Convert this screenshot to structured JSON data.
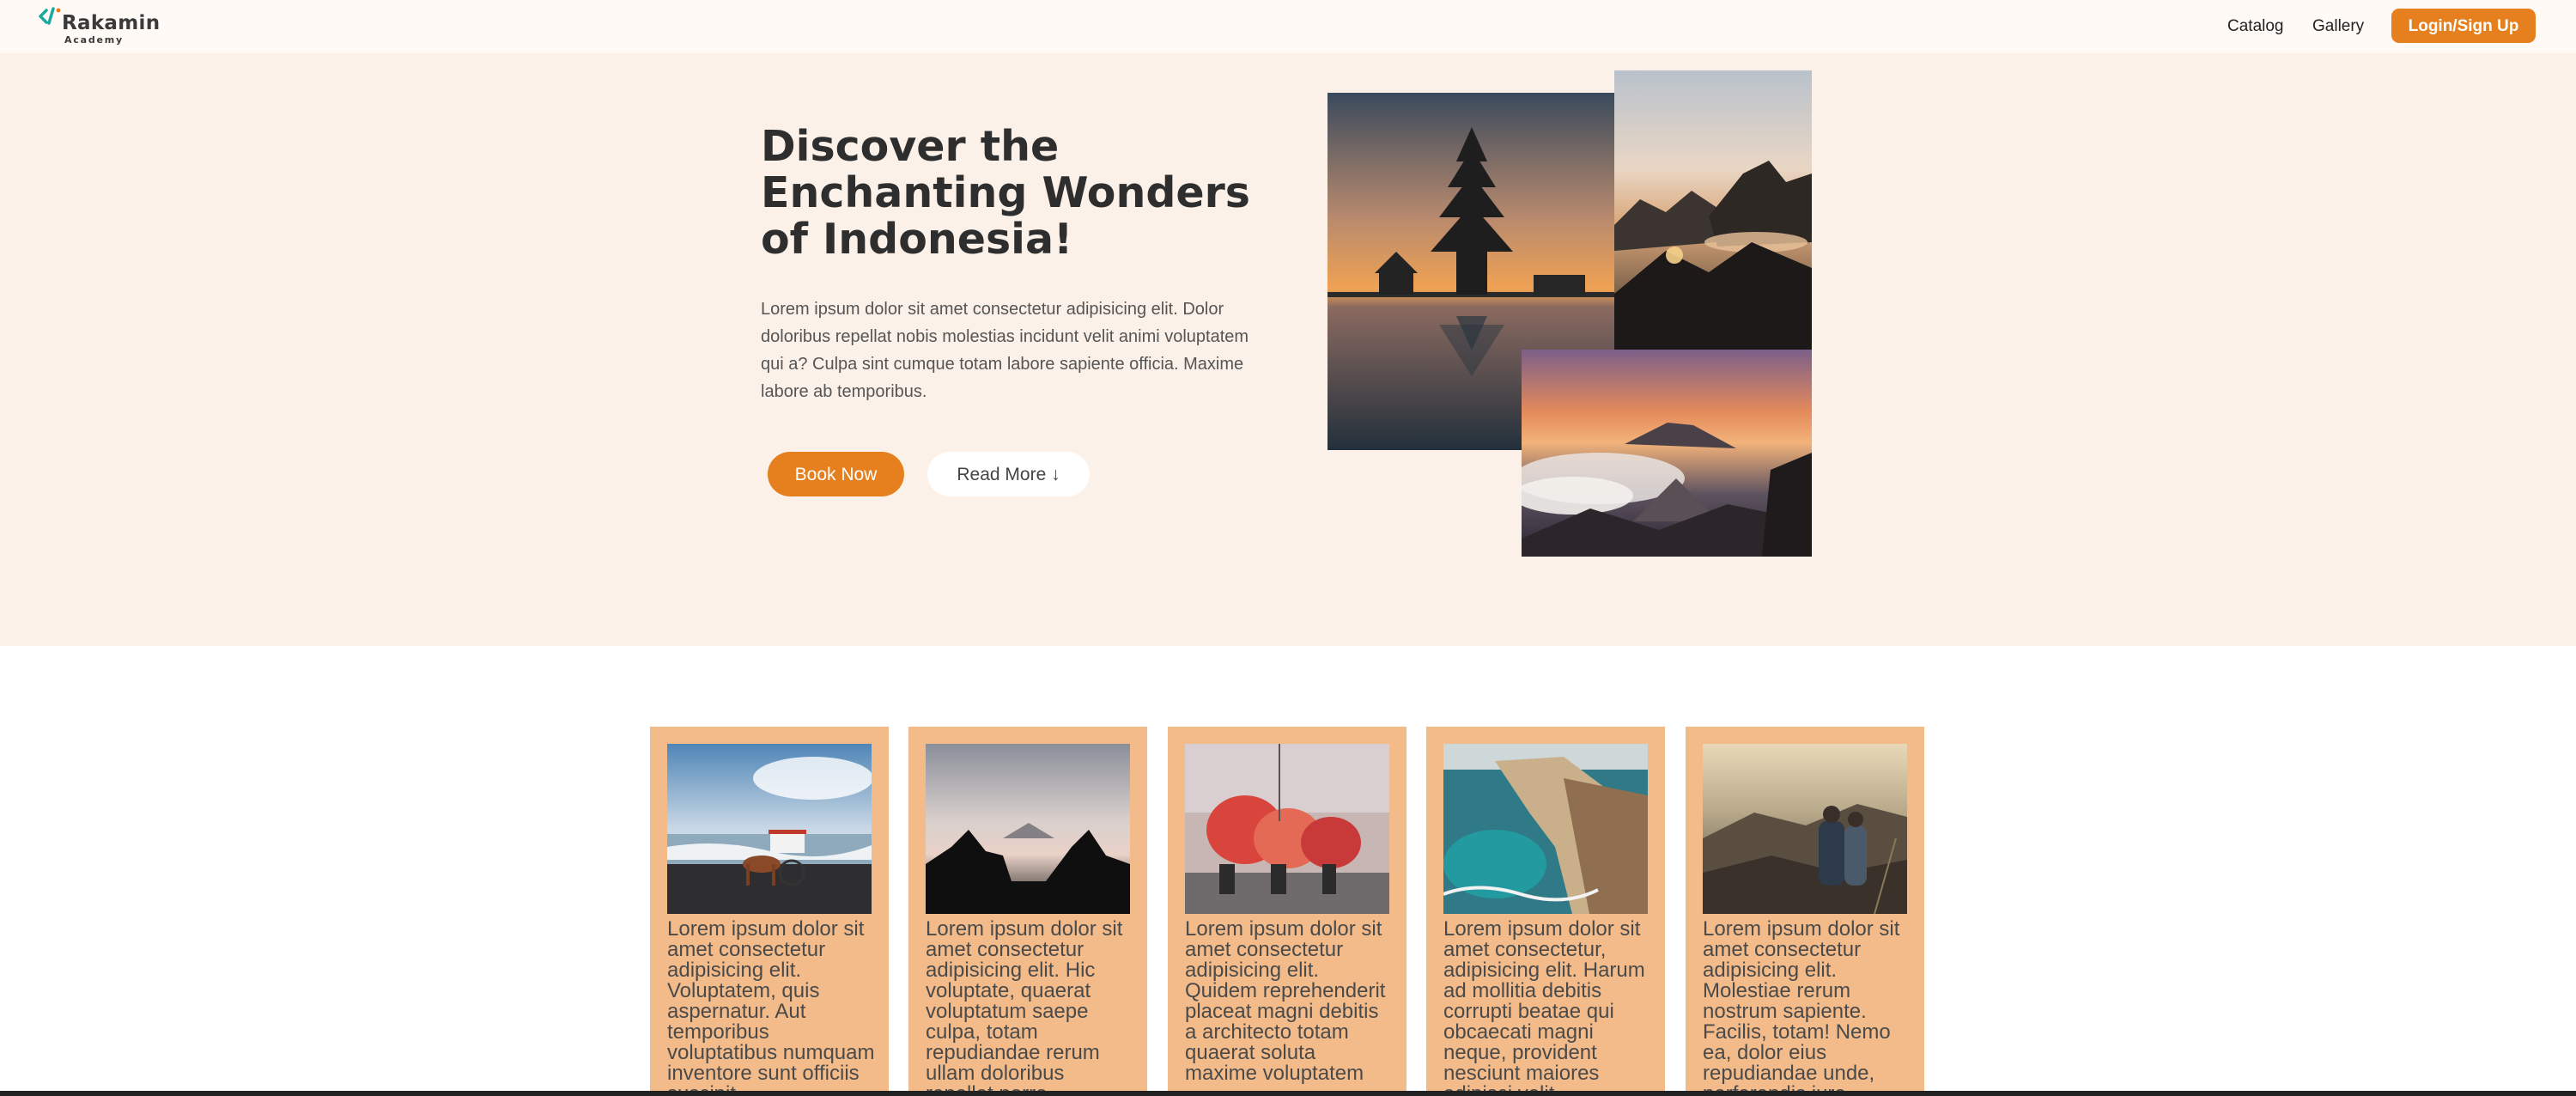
{
  "navbar": {
    "logo": {
      "name": "Rakamin",
      "sub": "Academy",
      "icon": "code-bracket-logo"
    },
    "links": [
      "Catalog",
      "Gallery"
    ],
    "login_label": "Login/Sign Up"
  },
  "hero": {
    "title": "Discover the Enchanting Wonders of Indonesia!",
    "description": "Lorem ipsum dolor sit amet consectetur adipisicing elit. Dolor doloribus repellat nobis molestias incidunt velit animi voluptatem qui a? Culpa sint cumque totam labore sapiente officia. Maxime labore ab temporibus.",
    "book_label": "Book Now",
    "read_label": "Read More ↓",
    "images": [
      "temple-on-lake-sunset",
      "rocky-islands-sunrise",
      "volcano-crater-clouds"
    ]
  },
  "cards": [
    {
      "image": "horse-cart-on-beach",
      "text": "Lorem ipsum dolor sit amet consectetur adipisicing elit. Voluptatem, quis aspernatur. Aut temporibus voluptatibus numquam inventore sunt officiis suscipit"
    },
    {
      "image": "temple-silhouette-dusk",
      "text": "Lorem ipsum dolor sit amet consectetur adipisicing elit. Hic voluptate, quaerat voluptatum saepe culpa, totam repudiandae rerum ullam doloribus repellat porro"
    },
    {
      "image": "street-dance-parade",
      "text": "Lorem ipsum dolor sit amet consectetur adipisicing elit. Quidem reprehenderit placeat magni debitis a architecto totam quaerat soluta maxime voluptatem"
    },
    {
      "image": "turquoise-sea-cliffs",
      "text": "Lorem ipsum dolor sit amet consectetur, adipisicing elit. Harum ad mollitia debitis corrupti beatae qui obcaecati magni neque, provident nesciunt maiores adipisci velit"
    },
    {
      "image": "hikers-on-mountain",
      "text": "Lorem ipsum dolor sit amet consectetur adipisicing elit. Molestiae rerum nostrum sapiente. Facilis, totam! Nemo ea, dolor eius repudiandae unde, perferendis iure"
    }
  ],
  "colors": {
    "accent": "#e6801f",
    "hero_bg": "#fbf1e8",
    "card_bg": "#f3bb8a",
    "logo_accent": "#1aa8a0"
  }
}
